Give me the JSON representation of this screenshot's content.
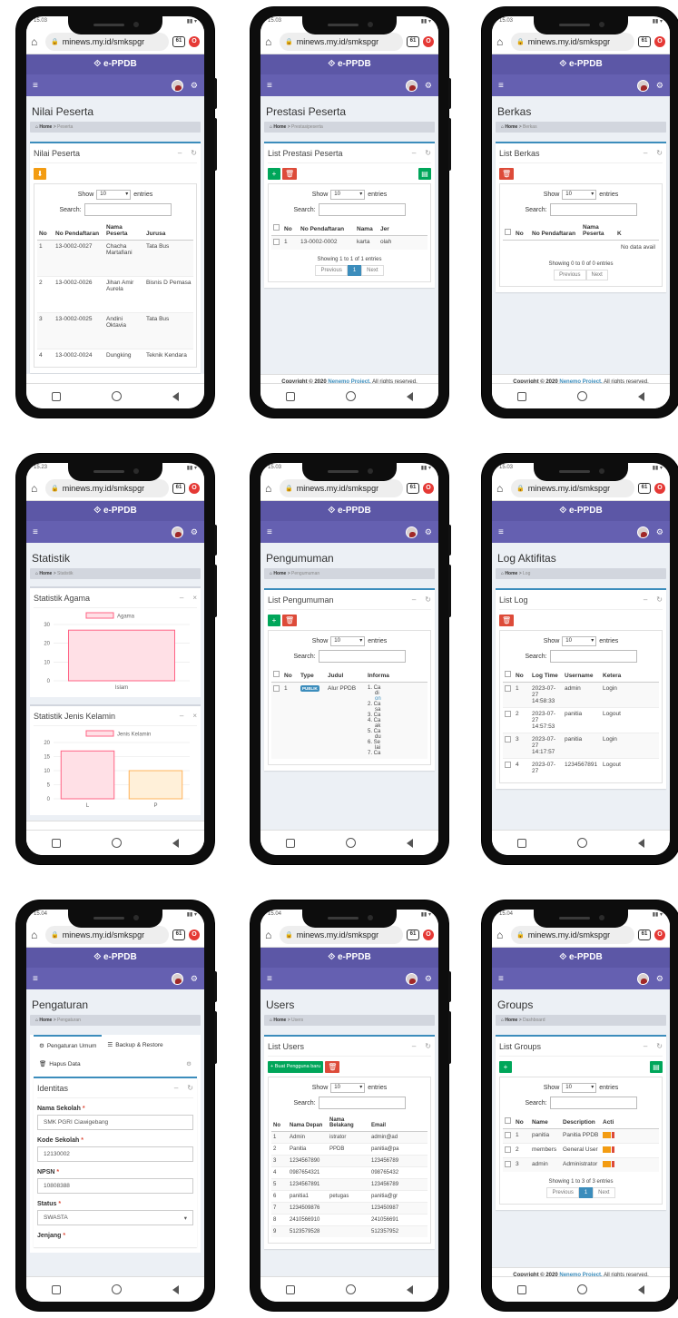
{
  "brand": "e-PPDB",
  "url": "minews.my.id/smkspgr",
  "tab_count": "61",
  "phones": [
    {
      "status_time": "15.03"
    },
    {
      "status_time": "15.03"
    },
    {
      "status_time": "15.03"
    },
    {
      "status_time": "15.23"
    },
    {
      "status_time": "15.03"
    },
    {
      "status_time": "15.03"
    },
    {
      "status_time": "15.04"
    },
    {
      "status_time": "15.04"
    },
    {
      "status_time": "15.04"
    }
  ],
  "common": {
    "home": "Home",
    "show": "Show",
    "entries_value": "10",
    "entries": "entries",
    "search": "Search:",
    "previous": "Previous",
    "next": "Next",
    "page": "1",
    "copyright": "Copyright © 2020",
    "project": "Nenemo Project.",
    "rights": "All rights reserved."
  },
  "nilai": {
    "title": "Nilai Peserta",
    "crumb": "Peserta",
    "box_title": "Nilai Peserta",
    "headers": [
      "No",
      "No Pendaftaran",
      "Nama Peserta",
      "Jurusa"
    ],
    "rows": [
      [
        "1",
        "13-0002-0027",
        "Chacha Martafiani",
        "Tata Bus"
      ],
      [
        "2",
        "13-0002-0026",
        "Jihan Amir Aurela",
        "Bisnis D Pemasa"
      ],
      [
        "3",
        "13-0002-0025",
        "Andini Oktavia",
        "Tata Bus"
      ],
      [
        "4",
        "13-0002-0024",
        "Dungking",
        "Teknik Kendara"
      ]
    ]
  },
  "prestasi": {
    "title": "Prestasi Peserta",
    "crumb": "Prestasipeserta",
    "box_title": "List Prestasi Peserta",
    "headers": [
      "No",
      "No Pendaftaran",
      "Nama",
      "Jer"
    ],
    "rows": [
      [
        "1",
        "13-0002-0002",
        "karta",
        "olah"
      ]
    ],
    "info": "Showing 1 to 1 of 1 entries"
  },
  "berkas": {
    "title": "Berkas",
    "crumb": "Berkas",
    "box_title": "List Berkas",
    "headers": [
      "No",
      "No Pendaftaran",
      "Nama Peserta",
      "K"
    ],
    "nodata": "No data avail",
    "info": "Showing 0 to 0 of 0 entries"
  },
  "statistik": {
    "title": "Statistik",
    "crumb": "Statistik",
    "agama_title": "Statistik Agama",
    "jk_title": "Statistik Jenis Kelamin"
  },
  "chart_data": [
    {
      "type": "bar",
      "title": "",
      "categories": [
        "Islam"
      ],
      "series": [
        {
          "name": "Agama",
          "values": [
            27
          ]
        }
      ],
      "ylim": [
        0,
        30
      ],
      "yticks": [
        "30",
        "20",
        "10",
        "0"
      ],
      "colors": {
        "fill": "#ffe0e6",
        "stroke": "#ff6384"
      }
    },
    {
      "type": "bar",
      "title": "",
      "categories": [
        "L",
        "P"
      ],
      "series": [
        {
          "name": "Jenis Kelamin",
          "values": [
            17,
            10
          ]
        }
      ],
      "ylim": [
        0,
        20
      ],
      "yticks": [
        "20",
        "15",
        "10",
        "5",
        "0"
      ],
      "colors": {
        "fill": [
          "#ffe0e6",
          "#fff0d9"
        ],
        "stroke": [
          "#ff6384",
          "#ffb35a"
        ]
      }
    }
  ],
  "pengumuman": {
    "title": "Pengumuman",
    "crumb": "Pengumuman",
    "box_title": "List Pengumuman",
    "headers": [
      "No",
      "Type",
      "Judul",
      "Informa"
    ],
    "row": {
      "no": "1",
      "type": "PUBLIK",
      "judul": "Alur PPDB"
    },
    "info_items": [
      "1. Ca",
      "di",
      "on",
      "2. Ca",
      "sa",
      "3. Ca",
      "4. Ca",
      "ak",
      "5. Ca",
      "du",
      "6. Se",
      "lai",
      "7. Ca"
    ]
  },
  "log": {
    "title": "Log Aktifitas",
    "crumb": "Log",
    "box_title": "List Log",
    "headers": [
      "No",
      "Log Time",
      "Username",
      "Ketera"
    ],
    "rows": [
      [
        "1",
        "2023-07-27 14:58:33",
        "admin",
        "Login"
      ],
      [
        "2",
        "2023-07-27 14:57:53",
        "panitia",
        "Logout"
      ],
      [
        "3",
        "2023-07-27 14:17:57",
        "panitia",
        "Login"
      ],
      [
        "4",
        "2023-07-27",
        "1234567891",
        "Logout"
      ]
    ]
  },
  "pengaturan": {
    "title": "Pengaturan",
    "crumb": "Pengaturan",
    "tab1": "Pengaturan Umum",
    "tab2": "Backup & Restore",
    "tab3": "Hapus Data",
    "box_title": "Identitas",
    "fields": [
      {
        "label": "Nama Sekolah",
        "value": "SMK PGRI Ciawigebang"
      },
      {
        "label": "Kode Sekolah",
        "value": "12130002"
      },
      {
        "label": "NPSN",
        "value": "10808388"
      },
      {
        "label": "Status",
        "value": "SWASTA"
      },
      {
        "label": "Jenjang",
        "value": ""
      }
    ]
  },
  "users": {
    "title": "Users",
    "crumb": "Users",
    "box_title": "List Users",
    "add_btn": "Buat Pengguna baru",
    "headers": [
      "No",
      "Nama Depan",
      "Nama Belakang",
      "Email"
    ],
    "rows": [
      [
        "1",
        "Admin",
        "istrator",
        "admin@ad"
      ],
      [
        "2",
        "Panitia",
        "PPDB",
        "panitia@pa"
      ],
      [
        "3",
        "1234567890",
        "",
        "123456789"
      ],
      [
        "4",
        "0987654321",
        "",
        "098765432"
      ],
      [
        "5",
        "1234567891",
        "",
        "123456789"
      ],
      [
        "6",
        "panitia1",
        "petugas",
        "panitia@gr"
      ],
      [
        "7",
        "1234509876",
        "",
        "123450987"
      ],
      [
        "8",
        "2410566910",
        "",
        "241056691"
      ],
      [
        "9",
        "5123579528",
        "",
        "512357952"
      ]
    ]
  },
  "groups": {
    "title": "Groups",
    "crumb": "Dashboard",
    "box_title": "List Groups",
    "headers": [
      "No",
      "Name",
      "Description",
      "Acti"
    ],
    "rows": [
      [
        "1",
        "panitia",
        "Panitia PPDB"
      ],
      [
        "2",
        "members",
        "General User"
      ],
      [
        "3",
        "admin",
        "Administrator"
      ]
    ],
    "info": "Showing 1 to 3 of 3 entries"
  }
}
